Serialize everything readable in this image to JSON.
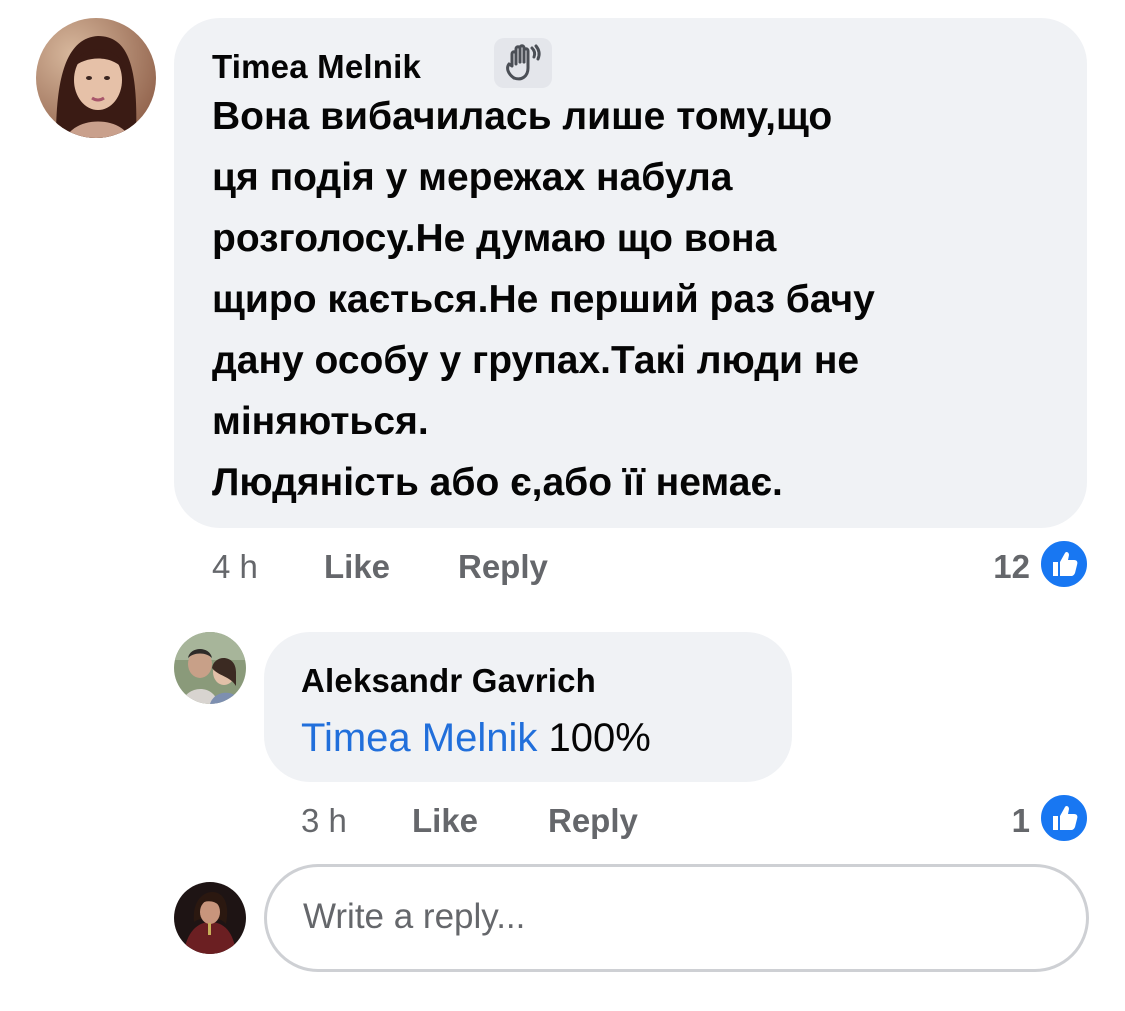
{
  "comment": {
    "author": "Timea Melnik",
    "badge_icon": "wave-hand-icon",
    "text_lines": [
      "Вона вибачилась лише  тому,що",
      "ця подія у мережах набула",
      "розголосу.Не думаю що вона",
      "щиро кається.Не перший раз бачу",
      "дану особу у групах.Такі люди не",
      "міняються.",
      "Людяність або є,або її немає."
    ],
    "time": "4 h",
    "like_label": "Like",
    "reply_label": "Reply",
    "reaction_count": "12",
    "reaction_icon": "thumbs-up-icon"
  },
  "reply": {
    "author": "Aleksandr Gavrich",
    "mention": "Timea Melnik",
    "text": " 100%",
    "time": "3 h",
    "like_label": "Like",
    "reply_label": "Reply",
    "reaction_count": "1",
    "reaction_icon": "thumbs-up-icon"
  },
  "composer": {
    "placeholder": "Write a reply..."
  },
  "colors": {
    "bubble": "#f0f2f5",
    "meta_text": "#65676b",
    "mention": "#216fdb",
    "like_blue": "#1877f2"
  }
}
